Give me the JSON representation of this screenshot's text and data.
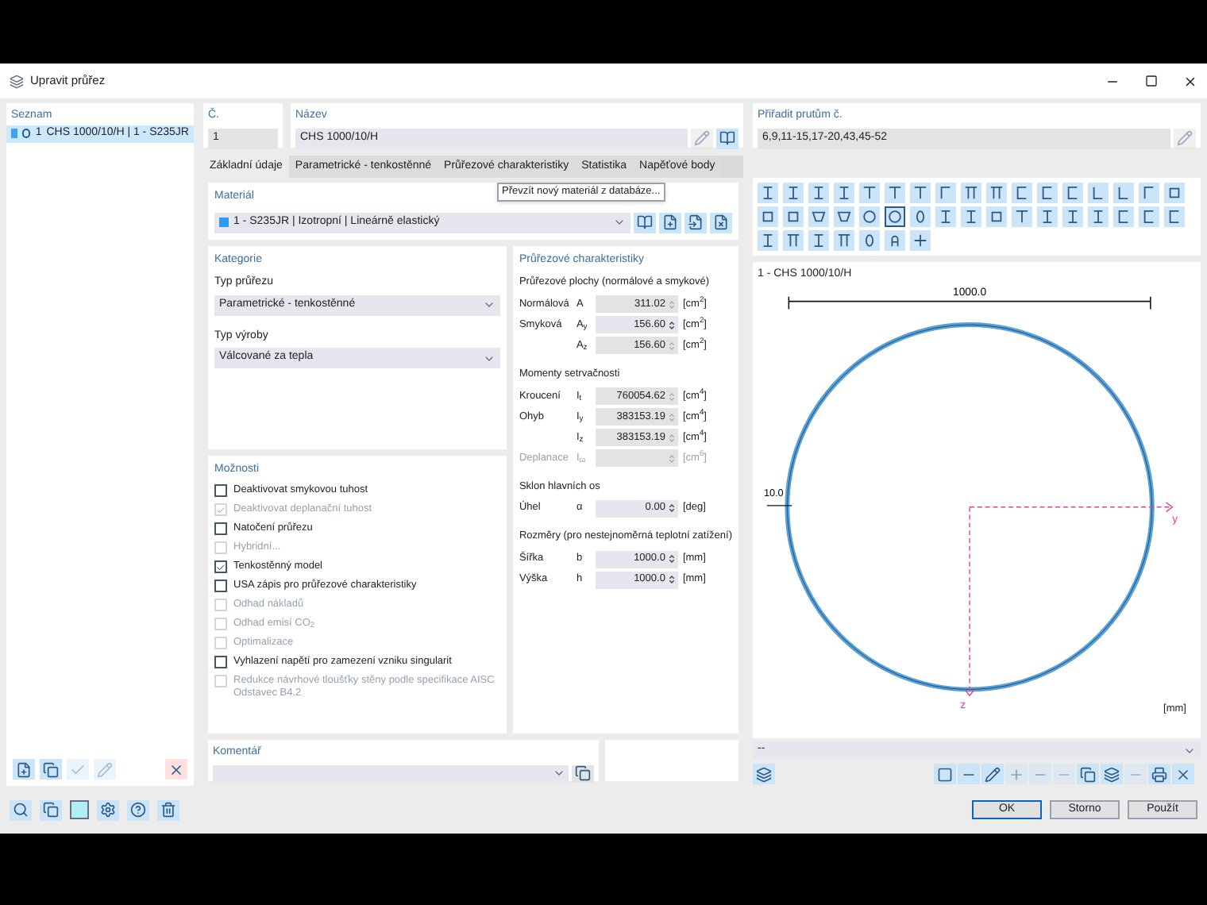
{
  "window": {
    "title": "Upravit průřez"
  },
  "list": {
    "title": "Seznam",
    "items": [
      {
        "number": "1",
        "label": "CHS 1000/10/H | 1 - S235JR",
        "color": "#3ea3f2",
        "selected": true
      }
    ]
  },
  "number_field": {
    "label": "Č.",
    "value": "1"
  },
  "name_field": {
    "label": "Název",
    "value": "CHS 1000/10/H"
  },
  "assign_field": {
    "label": "Přiřadit prutům č.",
    "value": "6,9,11-15,17-20,43,45-52"
  },
  "tabs": [
    {
      "label": "Základní údaje",
      "selected": true
    },
    {
      "label": "Parametrické - tenkostěnné",
      "selected": false
    },
    {
      "label": "Průřezové charakteristiky",
      "selected": false
    },
    {
      "label": "Statistika",
      "selected": false
    },
    {
      "label": "Napěťové body",
      "selected": false
    }
  ],
  "material": {
    "label": "Materiál",
    "value": "1 - S235JR | Izotropní | Lineárně elastický",
    "color": "#2f9cf0",
    "tooltip": "Převzít nový materiál z databáze..."
  },
  "category": {
    "title": "Kategorie",
    "fields": [
      {
        "label": "Typ průřezu",
        "value": "Parametrické - tenkostěnné"
      },
      {
        "label": "Typ výroby",
        "value": "Válcované za tepla"
      }
    ]
  },
  "options": {
    "title": "Možnosti",
    "items": [
      {
        "label": "Deaktivovat smykovou tuhost",
        "checked": false,
        "disabled": false
      },
      {
        "label": "Deaktivovat deplanační tuhost",
        "checked": true,
        "disabled": true
      },
      {
        "label": "Natočení průřezu",
        "checked": false,
        "disabled": false
      },
      {
        "label": "Hybridní...",
        "checked": false,
        "disabled": true
      },
      {
        "label": "Tenkostěnný model",
        "checked": true,
        "disabled": false
      },
      {
        "label": "USA zápis pro průřezové charakteristiky",
        "checked": false,
        "disabled": false
      },
      {
        "label": "Odhad nákladů",
        "checked": false,
        "disabled": true
      },
      {
        "label": "Odhad emisí CO$_{2}$",
        "checked": false,
        "disabled": true
      },
      {
        "label": "Optimalizace",
        "checked": false,
        "disabled": true
      },
      {
        "label": "Vyhlazení napětí pro zamezení vzniku singularit",
        "checked": false,
        "disabled": false
      },
      {
        "label": "Redukce návrhové tloušťky stěny podle specifikace AISC Odstavec B4.2",
        "checked": false,
        "disabled": true
      }
    ]
  },
  "properties": {
    "title": "Průřezové charakteristiky",
    "groups": [
      {
        "title": "Průřezové plochy (normálové a smykové)",
        "rows": [
          {
            "label": "Normálová",
            "symbol": "A",
            "value": "311.02",
            "unit": "[cm$^{2}$]",
            "editable": false,
            "disabled": false
          },
          {
            "label": "Smyková",
            "symbol": "A$_{y}$",
            "value": "156.60",
            "unit": "[cm$^{2}$]",
            "editable": true,
            "disabled": false
          },
          {
            "symbol": "A$_{z}$",
            "value": "156.60",
            "unit": "[cm$^{2}$]",
            "editable": false,
            "disabled": false
          }
        ]
      },
      {
        "title": "Momenty setrvačnosti",
        "rows": [
          {
            "label": "Kroucení",
            "symbol": "I$_{t}$",
            "value": "760054.62",
            "unit": "[cm$^{4}$]",
            "editable": false,
            "disabled": false
          },
          {
            "label": "Ohyb",
            "symbol": "I$_{y}$",
            "value": "383153.19",
            "unit": "[cm$^{4}$]",
            "editable": false,
            "disabled": false
          },
          {
            "symbol": "I$_{z}$",
            "value": "383153.19",
            "unit": "[cm$^{4}$]",
            "editable": false,
            "disabled": false
          },
          {
            "label": "Deplanace",
            "symbol": "I$_{ω}$",
            "unit": "[cm$^{6}$]",
            "editable": false,
            "disabled": true
          }
        ]
      },
      {
        "title": "Sklon hlavních os",
        "rows": [
          {
            "label": "Úhel",
            "symbol": "α",
            "value": "0.00",
            "unit": "[deg]",
            "editable": true,
            "disabled": false
          }
        ]
      },
      {
        "title": "Rozměry (pro nestejnoměrná teplotní zatížení)",
        "rows": [
          {
            "label": "Šířka",
            "symbol": "b",
            "value": "1000.0",
            "unit": "[mm]",
            "editable": true,
            "disabled": false
          },
          {
            "label": "Výška",
            "symbol": "h",
            "value": "1000.0",
            "unit": "[mm]",
            "editable": true,
            "disabled": false
          }
        ]
      }
    ]
  },
  "comment": {
    "label": "Komentář"
  },
  "shape_buttons": [
    {
      "kind": "i-beam",
      "selected": false
    },
    {
      "kind": "i-beam",
      "selected": false
    },
    {
      "kind": "i-beam",
      "selected": false
    },
    {
      "kind": "i-beam",
      "selected": false
    },
    {
      "kind": "t-beam",
      "selected": false
    },
    {
      "kind": "t-beam",
      "selected": false
    },
    {
      "kind": "t-beam",
      "selected": false
    },
    {
      "kind": "angle-top",
      "selected": false
    },
    {
      "kind": "pi",
      "selected": false
    },
    {
      "kind": "pi",
      "selected": false
    },
    {
      "kind": "channel",
      "selected": false
    },
    {
      "kind": "channel",
      "selected": false
    },
    {
      "kind": "channel",
      "selected": false
    },
    {
      "kind": "angle",
      "selected": false
    },
    {
      "kind": "angle",
      "selected": false
    },
    {
      "kind": "angle-top",
      "selected": false
    },
    {
      "kind": "box",
      "selected": false
    },
    {
      "kind": "box",
      "selected": false
    },
    {
      "kind": "box",
      "selected": false
    },
    {
      "kind": "trapezoid",
      "selected": false
    },
    {
      "kind": "trapezoid",
      "selected": false
    },
    {
      "kind": "tube",
      "selected": false
    },
    {
      "kind": "tube",
      "selected": true
    },
    {
      "kind": "oval",
      "selected": false
    },
    {
      "kind": "i-beam",
      "selected": false
    },
    {
      "kind": "i-beam",
      "selected": false
    },
    {
      "kind": "box",
      "selected": false
    },
    {
      "kind": "t-beam",
      "selected": false
    },
    {
      "kind": "i-beam",
      "selected": false
    },
    {
      "kind": "i-beam",
      "selected": false
    },
    {
      "kind": "i-beam",
      "selected": false
    },
    {
      "kind": "channel",
      "selected": false
    },
    {
      "kind": "channel",
      "selected": false
    },
    {
      "kind": "channel",
      "selected": false
    },
    {
      "kind": "i-beam",
      "selected": false
    },
    {
      "kind": "pi",
      "selected": false
    },
    {
      "kind": "i-beam",
      "selected": false
    },
    {
      "kind": "pi",
      "selected": false
    },
    {
      "kind": "oval",
      "selected": false
    },
    {
      "kind": "arch",
      "selected": false
    },
    {
      "kind": "plus",
      "selected": false
    }
  ],
  "preview": {
    "title": "1 - CHS 1000/10/H",
    "width_dimension": "1000.0",
    "thickness_dimension": "10.0",
    "axis_y": "y",
    "axis_z": "z",
    "unit": "[mm]"
  },
  "view_select": {
    "value": "--"
  },
  "buttons": [
    {
      "label": "OK",
      "default": true
    },
    {
      "label": "Storno",
      "default": false
    },
    {
      "label": "Použít",
      "default": false
    }
  ]
}
